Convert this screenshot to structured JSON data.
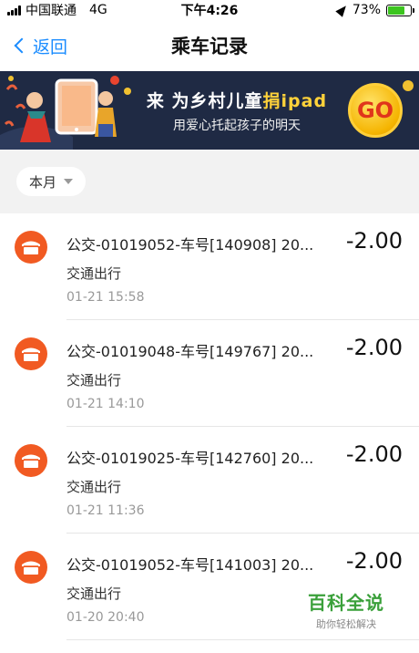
{
  "status_bar": {
    "carrier": "中国联通",
    "network": "4G",
    "time": "下午4:26",
    "battery_percent": "73%",
    "battery_level": 0.73,
    "signal_icon": "signal-bars-icon",
    "location_icon": "location-arrow-icon"
  },
  "nav": {
    "back_label": "返回",
    "title": "乘车记录"
  },
  "banner": {
    "line1_prefix": "来 为乡村儿童",
    "line1_highlight": "捐ipad",
    "line2": "用爱心托起孩子的明天",
    "go_label": "GO"
  },
  "filter": {
    "month_label": "本月"
  },
  "records": [
    {
      "title": "公交-01019052-车号[140908] 20...",
      "amount": "-2.00",
      "category": "交通出行",
      "time": "01-21  15:58"
    },
    {
      "title": "公交-01019048-车号[149767] 20...",
      "amount": "-2.00",
      "category": "交通出行",
      "time": "01-21  14:10"
    },
    {
      "title": "公交-01019025-车号[142760] 20...",
      "amount": "-2.00",
      "category": "交通出行",
      "time": "01-21  11:36"
    },
    {
      "title": "公交-01019052-车号[141003] 20...",
      "amount": "-2.00",
      "category": "交通出行",
      "time": "01-20  20:40"
    }
  ],
  "watermark": {
    "brand": "百科全说",
    "slogan": "助你轻松解决"
  },
  "colors": {
    "accent_blue": "#1a8cff",
    "icon_orange": "#f15a22",
    "battery_green": "#3cc51f",
    "banner_bg": "#1f2a44",
    "watermark_green": "#3aa03a"
  }
}
